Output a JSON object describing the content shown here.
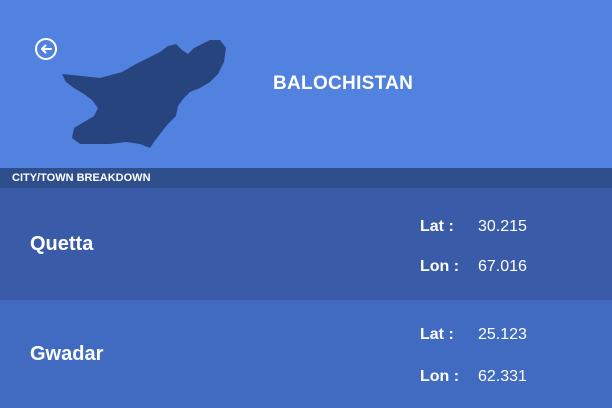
{
  "header": {
    "title": "BALOCHISTAN",
    "back_icon": "arrow-left-circle-icon",
    "map_icon": "province-map-silhouette",
    "colors": {
      "background": "#5282e0",
      "map": "#28447e"
    }
  },
  "section": {
    "label": "CITY/TOWN BREAKDOWN"
  },
  "cities": [
    {
      "name": "Quetta",
      "lat_label": "Lat :",
      "lat": "30.215",
      "lon_label": "Lon :",
      "lon": "67.016"
    },
    {
      "name": "Gwadar",
      "lat_label": "Lat :",
      "lat": "25.123",
      "lon_label": "Lon :",
      "lon": "62.331"
    }
  ]
}
